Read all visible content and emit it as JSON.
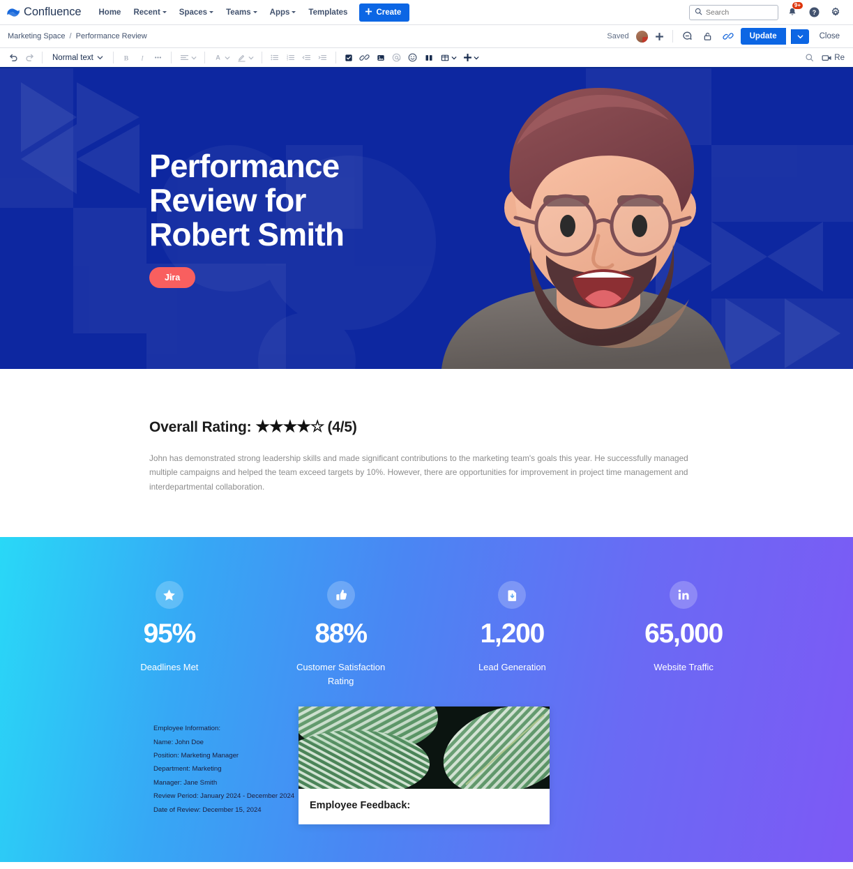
{
  "topnav": {
    "product": "Confluence",
    "items": [
      {
        "label": "Home",
        "caret": false
      },
      {
        "label": "Recent",
        "caret": true
      },
      {
        "label": "Spaces",
        "caret": true
      },
      {
        "label": "Teams",
        "caret": true
      },
      {
        "label": "Apps",
        "caret": true
      },
      {
        "label": "Templates",
        "caret": false
      }
    ],
    "create_label": "Create",
    "search_placeholder": "Search",
    "notification_badge": "9+"
  },
  "crumbbar": {
    "space": "Marketing Space",
    "separator": "/",
    "page": "Performance Review",
    "saved_label": "Saved",
    "update_label": "Update",
    "close_label": "Close"
  },
  "toolbar": {
    "text_style": "Normal text",
    "record_label": "Re"
  },
  "hero": {
    "title_line1": "Performance",
    "title_line2": "Review for",
    "title_line3": "Robert Smith",
    "tag": "Jira",
    "bg_color": "#0d27a0",
    "tag_color": "#f95f5f"
  },
  "rating": {
    "label": "Overall Rating:",
    "stars": "★★★★☆",
    "score": "(4/5)",
    "body": "John has demonstrated strong leadership skills and made significant contributions to the marketing team's goals this year. He successfully managed multiple campaigns and helped the team exceed targets by 10%. However, there are opportunities for improvement in project time management and interdepartmental collaboration."
  },
  "stats": [
    {
      "icon": "star-icon",
      "value": "95%",
      "label": "Deadlines Met"
    },
    {
      "icon": "thumbs-up-icon",
      "value": "88%",
      "label": "Customer Satisfaction Rating"
    },
    {
      "icon": "document-download-icon",
      "value": "1,200",
      "label": "Lead Generation"
    },
    {
      "icon": "linkedin-icon",
      "value": "65,000",
      "label": "Website Traffic"
    }
  ],
  "employee_info": {
    "heading": "Employee Information:",
    "lines": [
      "Name: John Doe",
      "Position: Marketing Manager",
      "Department: Marketing",
      "Manager: Jane Smith",
      "Review Period: January 2024 - December 2024",
      "Date of Review: December 15, 2024"
    ]
  },
  "feedback": {
    "title": "Employee Feedback:"
  },
  "colors": {
    "brand_blue": "#0c66e4",
    "hero_blue": "#0d27a0",
    "gradient_start": "#29d8f7",
    "gradient_end": "#7d59f5",
    "jira_red": "#f95f5f",
    "badge_red": "#de350b"
  }
}
